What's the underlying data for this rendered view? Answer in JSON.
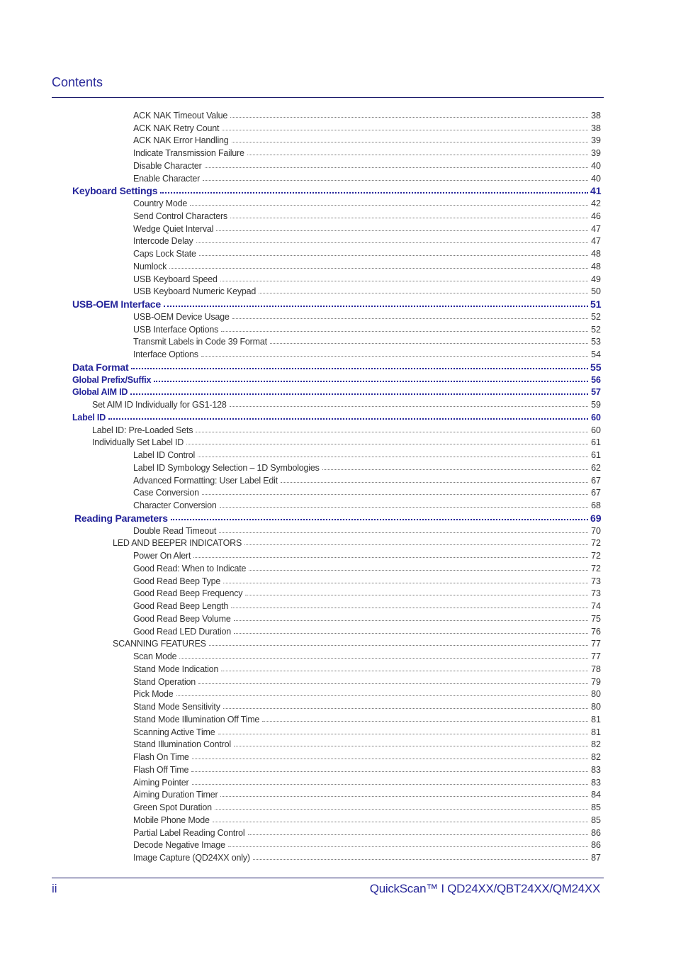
{
  "header": {
    "title": "Contents"
  },
  "colors": {
    "accent": "#24249a",
    "text": "#333333"
  },
  "toc": [
    {
      "level": "3",
      "label": "ACK NAK Timeout Value",
      "page": "38"
    },
    {
      "level": "3",
      "label": "ACK NAK Retry Count",
      "page": "38"
    },
    {
      "level": "3",
      "label": "ACK NAK Error Handling",
      "page": "39"
    },
    {
      "level": "3",
      "label": "Indicate Transmission Failure",
      "page": "39"
    },
    {
      "level": "3",
      "label": "Disable Character",
      "page": "40"
    },
    {
      "level": "3",
      "label": "Enable Character",
      "page": "40"
    },
    {
      "level": "h",
      "label": "Keyboard Settings",
      "page": "41"
    },
    {
      "level": "3",
      "label": "Country Mode",
      "page": "42"
    },
    {
      "level": "3",
      "label": "Send Control Characters",
      "page": "46"
    },
    {
      "level": "3",
      "label": "Wedge Quiet Interval",
      "page": "47"
    },
    {
      "level": "3",
      "label": "Intercode Delay",
      "page": "47"
    },
    {
      "level": "3",
      "label": "Caps Lock State",
      "page": "48"
    },
    {
      "level": "3",
      "label": "Numlock",
      "page": "48"
    },
    {
      "level": "3",
      "label": "USB Keyboard Speed",
      "page": "49"
    },
    {
      "level": "3",
      "label": "USB Keyboard Numeric Keypad",
      "page": "50"
    },
    {
      "level": "h",
      "label": "USB-OEM Interface",
      "page": "51"
    },
    {
      "level": "3",
      "label": "USB-OEM Device Usage",
      "page": "52"
    },
    {
      "level": "3",
      "label": "USB Interface Options",
      "page": "52"
    },
    {
      "level": "3",
      "label": "Transmit Labels in Code 39 Format",
      "page": "53"
    },
    {
      "level": "3",
      "label": "Interface Options",
      "page": "54"
    },
    {
      "level": "h",
      "label": "Data Format",
      "page": "55"
    },
    {
      "level": "h2",
      "label": "Global Prefix/Suffix",
      "page": "56"
    },
    {
      "level": "h2",
      "label": "Global AIM ID",
      "page": "57"
    },
    {
      "level": "2",
      "label": "Set AIM ID Individually for GS1-128",
      "page": "59"
    },
    {
      "level": "h2",
      "label": "Label ID",
      "page": "60"
    },
    {
      "level": "2",
      "label": "Label ID: Pre-Loaded Sets",
      "page": "60"
    },
    {
      "level": "2",
      "label": "Individually Set Label ID",
      "page": "61"
    },
    {
      "level": "3",
      "label": "Label ID Control",
      "page": "61"
    },
    {
      "level": "3",
      "label": "Label ID Symbology Selection – 1D Symbologies",
      "page": "62"
    },
    {
      "level": "3",
      "label": "Advanced Formatting: User Label Edit",
      "page": "67"
    },
    {
      "level": "3",
      "label": "Case Conversion",
      "page": "67"
    },
    {
      "level": "3",
      "label": "Character Conversion",
      "page": "68"
    },
    {
      "level": "hr",
      "label": "Reading Parameters",
      "page": "69"
    },
    {
      "level": "3",
      "label": "Double Read Timeout",
      "page": "70"
    },
    {
      "level": "2b",
      "label": "LED AND BEEPER INDICATORS",
      "page": "72"
    },
    {
      "level": "3",
      "label": "Power On Alert",
      "page": "72"
    },
    {
      "level": "3",
      "label": "Good Read: When to Indicate",
      "page": "72"
    },
    {
      "level": "3",
      "label": "Good Read Beep Type",
      "page": "73"
    },
    {
      "level": "3",
      "label": "Good Read Beep Frequency",
      "page": "73"
    },
    {
      "level": "3",
      "label": "Good Read Beep Length",
      "page": "74"
    },
    {
      "level": "3",
      "label": "Good Read Beep Volume",
      "page": "75"
    },
    {
      "level": "3",
      "label": "Good Read LED Duration",
      "page": "76"
    },
    {
      "level": "2b",
      "label": "SCANNING FEATURES",
      "page": "77"
    },
    {
      "level": "3",
      "label": "Scan Mode",
      "page": "77"
    },
    {
      "level": "3",
      "label": "Stand Mode Indication",
      "page": "78"
    },
    {
      "level": "3",
      "label": "Stand Operation",
      "page": "79"
    },
    {
      "level": "3",
      "label": "Pick Mode",
      "page": "80"
    },
    {
      "level": "3",
      "label": "Stand Mode Sensitivity",
      "page": "80"
    },
    {
      "level": "3",
      "label": "Stand Mode Illumination Off Time",
      "page": "81"
    },
    {
      "level": "3",
      "label": "Scanning Active Time",
      "page": "81"
    },
    {
      "level": "3",
      "label": "Stand Illumination Control",
      "page": "82"
    },
    {
      "level": "3",
      "label": "Flash On Time",
      "page": "82"
    },
    {
      "level": "3",
      "label": "Flash Off Time",
      "page": "83"
    },
    {
      "level": "3",
      "label": "Aiming Pointer",
      "page": "83"
    },
    {
      "level": "3",
      "label": "Aiming Duration Timer",
      "page": "84"
    },
    {
      "level": "3",
      "label": "Green Spot Duration",
      "page": "85"
    },
    {
      "level": "3",
      "label": "Mobile Phone Mode",
      "page": "85"
    },
    {
      "level": "3",
      "label": "Partial Label Reading Control",
      "page": "86"
    },
    {
      "level": "3",
      "label": "Decode Negative Image",
      "page": "86"
    },
    {
      "level": "3",
      "label": "Image Capture (QD24XX only)",
      "page": "87"
    }
  ],
  "footer": {
    "page_number": "ii",
    "product": "QuickScan™ I QD24XX/QBT24XX/QM24XX"
  }
}
